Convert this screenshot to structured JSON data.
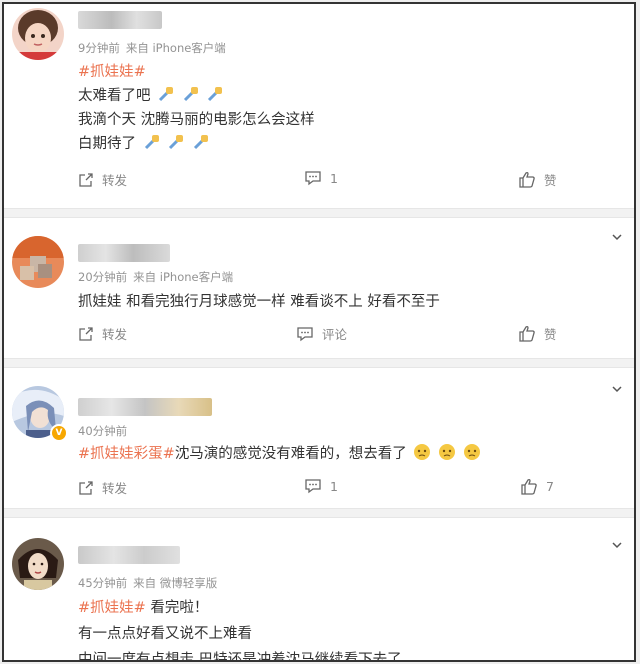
{
  "posts": [
    {
      "meta": {
        "time": "9分钟前",
        "source": "来自 iPhone客户端"
      },
      "lines": [
        {
          "tag": "#抓娃娃#",
          "text": ""
        },
        {
          "tag": "",
          "text": "太难看了吧"
        },
        {
          "tag": "",
          "text": "我滴个天 沈腾马丽的电影怎么会这样"
        },
        {
          "tag": "",
          "text": "白期待了"
        }
      ],
      "actions": {
        "repost": "转发",
        "comment": "1",
        "like": "赞"
      }
    },
    {
      "meta": {
        "time": "20分钟前",
        "source": "来自 iPhone客户端"
      },
      "lines": [
        {
          "tag": "",
          "text": "抓娃娃 和看完独行月球感觉一样 难看谈不上 好看不至于"
        }
      ],
      "actions": {
        "repost": "转发",
        "comment": "评论",
        "like": "赞"
      }
    },
    {
      "meta": {
        "time": "40分钟前",
        "source": ""
      },
      "lines": [
        {
          "tag": "#抓娃娃彩蛋#",
          "text": "沈马演的感觉没有难看的，想去看了"
        }
      ],
      "actions": {
        "repost": "转发",
        "comment": "1",
        "like": "7"
      }
    },
    {
      "meta": {
        "time": "45分钟前",
        "source": "来自 微博轻享版"
      },
      "lines": [
        {
          "tag": "#抓娃娃#",
          "text": " 看完啦！"
        },
        {
          "tag": "",
          "text": "有一点点好看又说不上难看"
        },
        {
          "tag": "",
          "text": "中间一度有点想走 巴特还是冲着沈马继续看下去了"
        }
      ],
      "actions": {
        "repost": "",
        "comment": "",
        "like": ""
      }
    }
  ],
  "icons": {
    "repost": "repost-icon",
    "comment": "comment-icon",
    "like": "thumbs-up-icon",
    "expand": "chevron-down-icon",
    "emoji_fist": "fist-emoji-icon",
    "emoji_awkward": "awkward-face-emoji-icon"
  },
  "colors": {
    "hashtag": "#eb7350",
    "meta": "#939393",
    "verified": "#f7a700"
  }
}
